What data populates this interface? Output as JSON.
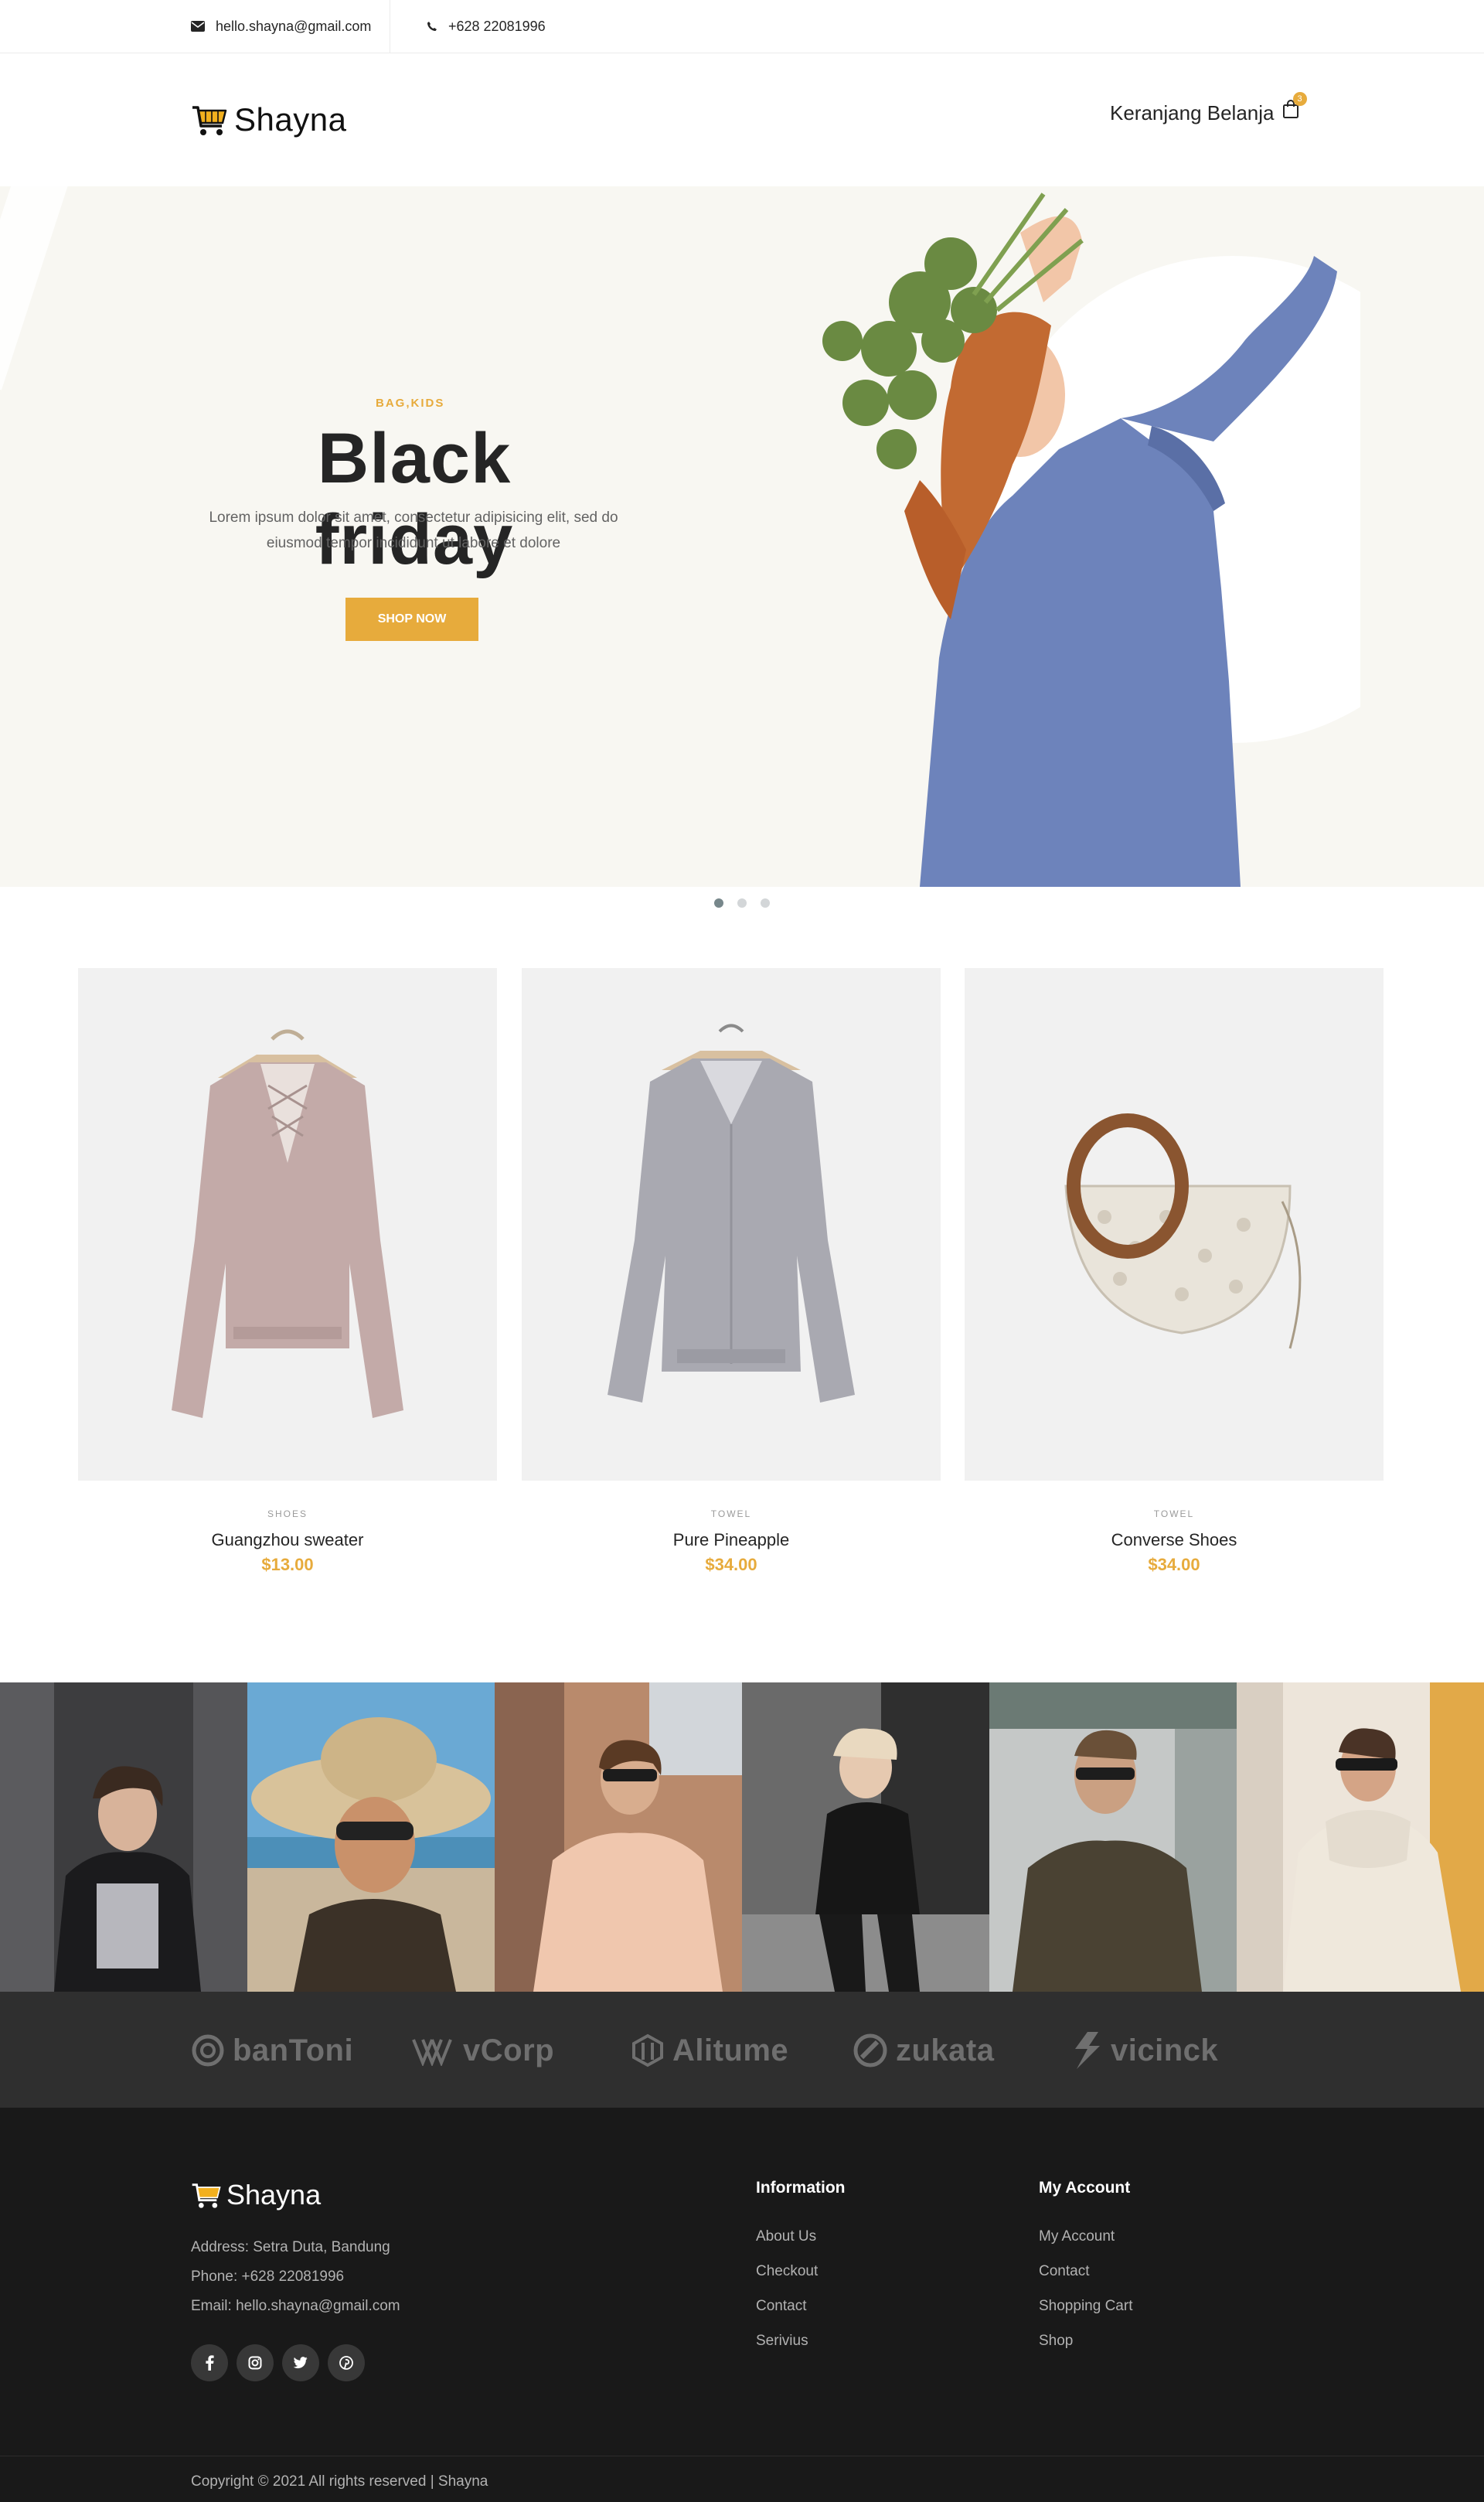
{
  "topbar": {
    "email": "hello.shayna@gmail.com",
    "phone": "+628 22081996"
  },
  "header": {
    "logo_text": "Shayna",
    "cart_label": "Keranjang Belanja",
    "cart_count": "3"
  },
  "hero": {
    "kicker": "BAG,KIDS",
    "headline": "Black friday",
    "description": "Lorem ipsum dolor sit amet, consectetur adipisicing elit, sed do eiusmod tempor incididunt ut labore et dolore",
    "button_label": "SHOP NOW"
  },
  "products": [
    {
      "category": "SHOES",
      "name": "Guangzhou sweater",
      "price": "$13.00"
    },
    {
      "category": "TOWEL",
      "name": "Pure Pineapple",
      "price": "$34.00"
    },
    {
      "category": "TOWEL",
      "name": "Converse Shoes",
      "price": "$34.00"
    }
  ],
  "partners": [
    "banToni",
    "vCorp",
    "Alitume",
    "zukata",
    "vicinck"
  ],
  "footer": {
    "logo_text": "Shayna",
    "address": "Address: Setra Duta, Bandung",
    "phone": "Phone: +628 22081996",
    "email": "Email: hello.shayna@gmail.com",
    "information": {
      "title": "Information",
      "links": [
        "About Us",
        "Checkout",
        "Contact",
        "Serivius"
      ]
    },
    "account": {
      "title": "My Account",
      "links": [
        "My Account",
        "Contact",
        "Shopping Cart",
        "Shop"
      ]
    },
    "copyright": "Copyright © 2021 All rights reserved | Shayna"
  },
  "colors": {
    "accent": "#e7ab3c",
    "dark": "#191919",
    "hero_bg": "#f8f7f2"
  }
}
